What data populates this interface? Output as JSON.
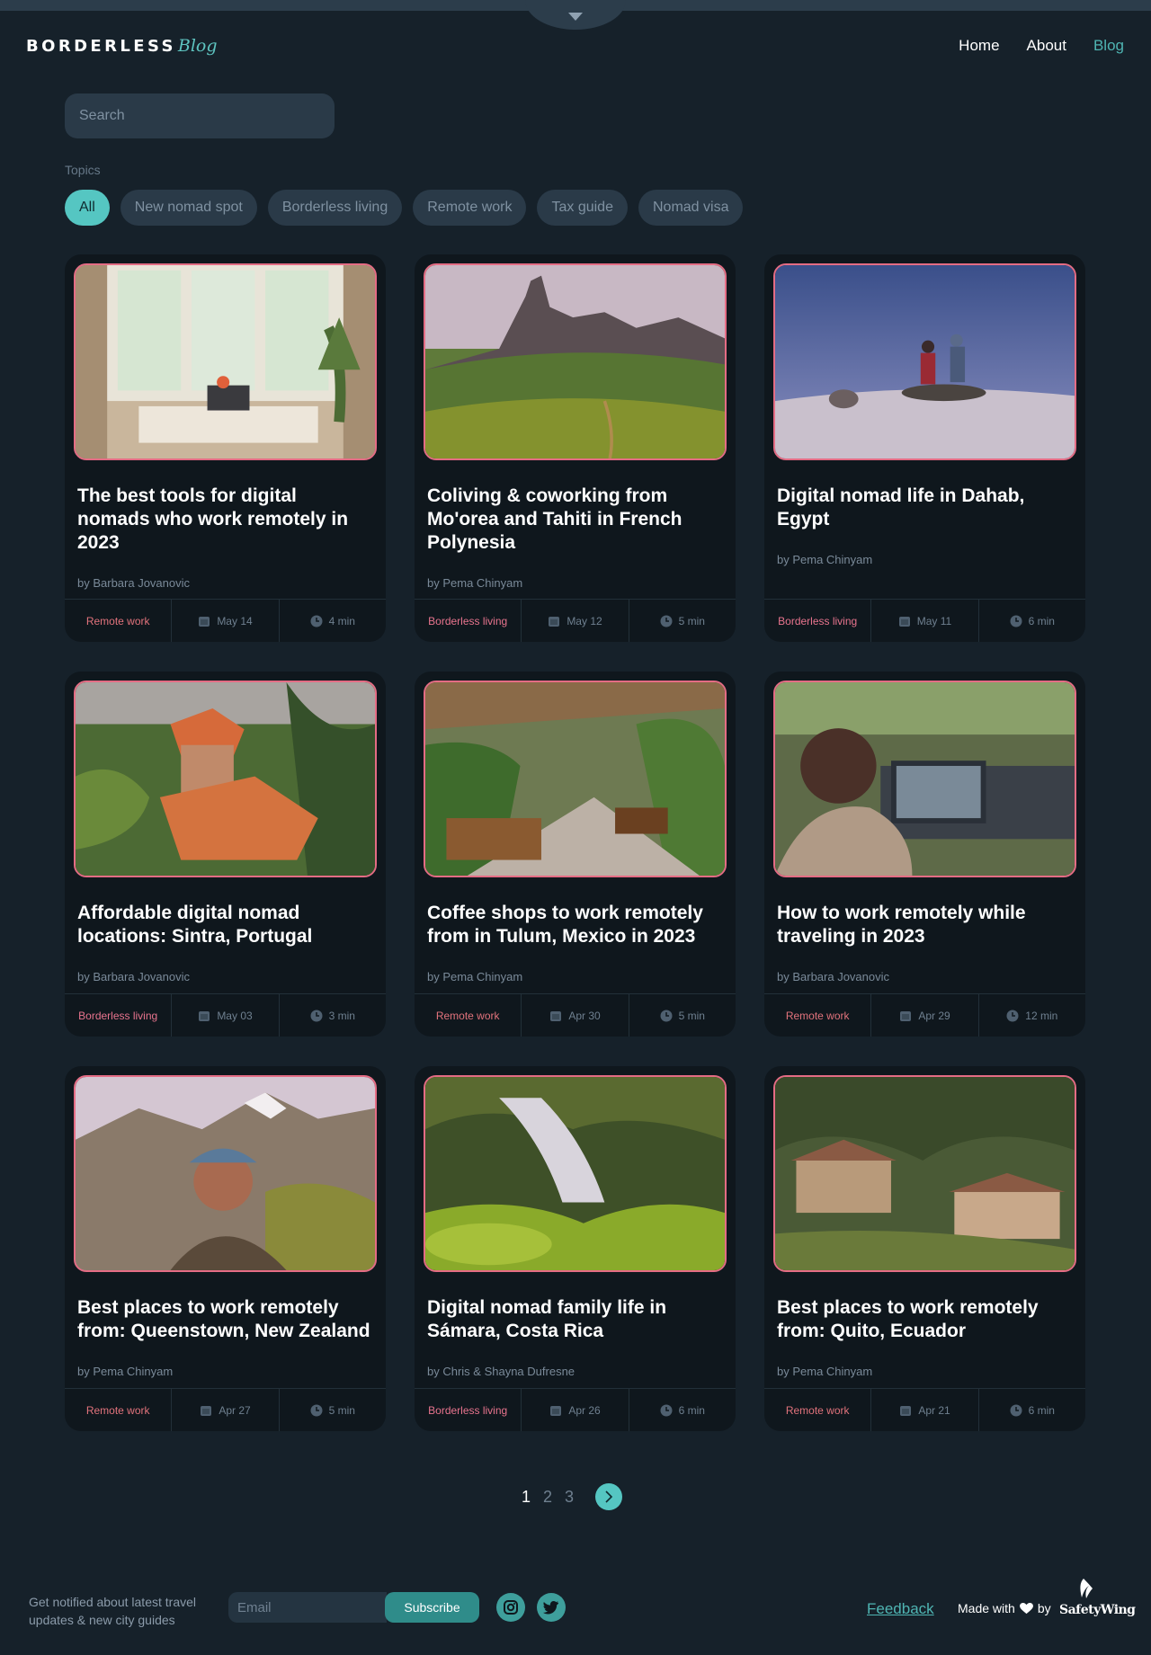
{
  "brand": {
    "name": "BORDERLESS",
    "sub": "Blog"
  },
  "nav": {
    "items": [
      "Home",
      "About",
      "Blog"
    ],
    "active": "Blog"
  },
  "search": {
    "placeholder": "Search",
    "value": ""
  },
  "topics": {
    "label": "Topics",
    "chips": [
      "All",
      "New nomad spot",
      "Borderless living",
      "Remote work",
      "Tax guide",
      "Nomad visa"
    ],
    "active": "All"
  },
  "colors": {
    "accent": "#55c6c2",
    "tag_red": "#e2737c",
    "tag_pink": "#e8748e",
    "card_border": "#e46c84"
  },
  "posts": [
    {
      "title": "The best tools for digital nomads who work remotely in 2023",
      "author": "by Barbara Jovanovic",
      "tag": "Remote work",
      "date": "May 14",
      "read": "4 min",
      "image": "sunlit desk by window"
    },
    {
      "title": "Coliving & coworking from Mo'orea and Tahiti in French Polynesia",
      "author": "by Pema Chinyam",
      "tag": "Borderless living",
      "date": "May 12",
      "read": "5 min",
      "image": "green mountain valley"
    },
    {
      "title": "Digital nomad life in Dahab, Egypt",
      "author": "by Pema Chinyam",
      "tag": "Borderless living",
      "date": "May 11",
      "read": "6 min",
      "image": "divers on sea floor"
    },
    {
      "title": "Affordable digital nomad locations: Sintra, Portugal",
      "author": "by Barbara Jovanovic",
      "tag": "Borderless living",
      "date": "May 03",
      "read": "3 min",
      "image": "castle roofs in forest"
    },
    {
      "title": "Coffee shops to work remotely from in Tulum, Mexico in 2023",
      "author": "by Pema Chinyam",
      "tag": "Remote work",
      "date": "Apr 30",
      "read": "5 min",
      "image": "open air cafe terrace"
    },
    {
      "title": "How to work remotely while traveling in 2023",
      "author": "by Barbara Jovanovic",
      "tag": "Remote work",
      "date": "Apr 29",
      "read": "12 min",
      "image": "woman working on laptop"
    },
    {
      "title": "Best places to work remotely from: Queenstown, New Zealand",
      "author": "by Pema Chinyam",
      "tag": "Remote work",
      "date": "Apr 27",
      "read": "5 min",
      "image": "hiker selfie in mountains"
    },
    {
      "title": "Digital nomad family life in Sámara, Costa Rica",
      "author": "by Chris & Shayna Dufresne",
      "tag": "Borderless living",
      "date": "Apr 26",
      "read": "6 min",
      "image": "jungle waterfall"
    },
    {
      "title": "Best places to work remotely from: Quito, Ecuador",
      "author": "by Pema Chinyam",
      "tag": "Remote work",
      "date": "Apr 21",
      "read": "6 min",
      "image": "hillside lodges in forest"
    }
  ],
  "pagination": {
    "pages": [
      "1",
      "2",
      "3"
    ],
    "current": "1"
  },
  "footer": {
    "notify_text": "Get notified about latest travel updates & new city guides",
    "email_placeholder": "Email",
    "subscribe_label": "Subscribe",
    "feedback_label": "Feedback",
    "made_with": "Made with",
    "by": "by",
    "safetywing": "SafetyWing"
  }
}
